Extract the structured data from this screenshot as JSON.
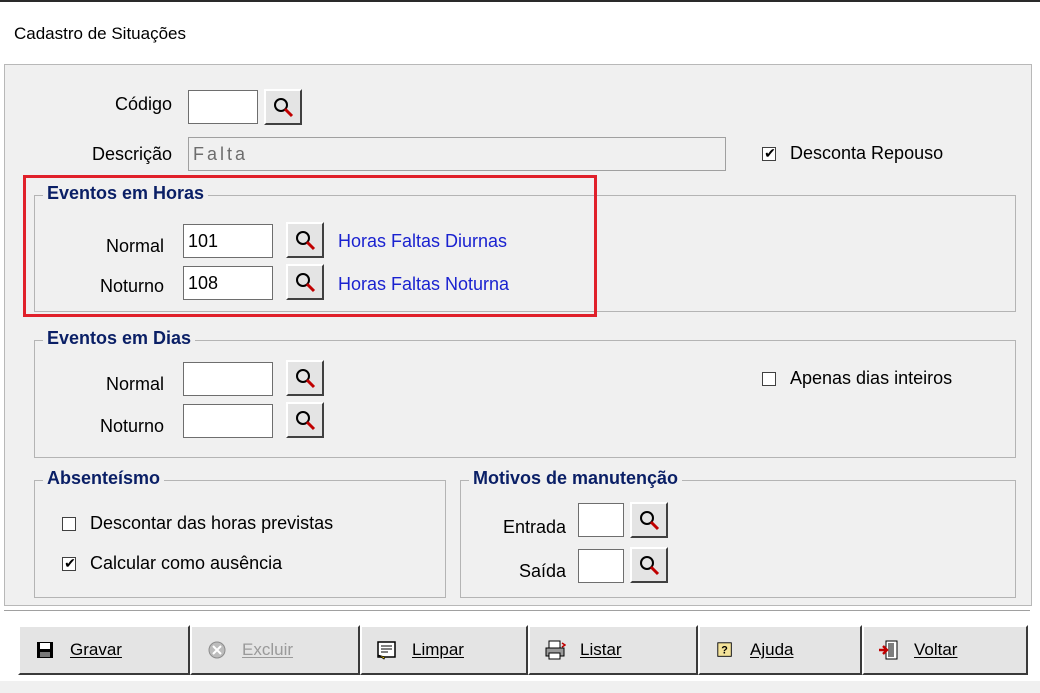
{
  "window": {
    "title": "Cadastro de Situações"
  },
  "header": {
    "codigo_label": "Código",
    "codigo_value": "",
    "descricao_label": "Descrição",
    "descricao_value": "Falta",
    "desconta_repouso": {
      "label": "Desconta Repouso",
      "checked": true
    }
  },
  "eventos_horas": {
    "title": "Eventos em Horas",
    "normal": {
      "label": "Normal",
      "code": "101",
      "description": "Horas Faltas Diurnas"
    },
    "noturno": {
      "label": "Noturno",
      "code": "108",
      "description": "Horas Faltas Noturna"
    }
  },
  "eventos_dias": {
    "title": "Eventos em Dias",
    "normal": {
      "label": "Normal",
      "code": ""
    },
    "noturno": {
      "label": "Noturno",
      "code": ""
    },
    "apenas_dias_inteiros": {
      "label": "Apenas dias inteiros",
      "checked": false
    }
  },
  "absenteismo": {
    "title": "Absenteísmo",
    "descontar_horas": {
      "label": "Descontar das horas previstas",
      "checked": false
    },
    "calcular_ausencia": {
      "label": "Calcular como ausência",
      "checked": true
    }
  },
  "motivos": {
    "title": "Motivos de manutenção",
    "entrada": {
      "label": "Entrada",
      "code": ""
    },
    "saida": {
      "label": "Saída",
      "code": ""
    }
  },
  "toolbar": {
    "gravar": "Gravar",
    "excluir": "Excluir",
    "limpar": "Limpar",
    "listar": "Listar",
    "ajuda": "Ajuda",
    "voltar": "Voltar"
  },
  "colors": {
    "highlight": "#e0202a",
    "group_title": "#0a1f66",
    "link": "#1a22d0"
  },
  "icons": {
    "lookup": "magnifier-icon",
    "gravar": "floppy-disk-icon",
    "excluir": "delete-icon",
    "limpar": "eraser-icon",
    "listar": "printer-icon",
    "ajuda": "help-icon",
    "voltar": "exit-door-icon"
  }
}
